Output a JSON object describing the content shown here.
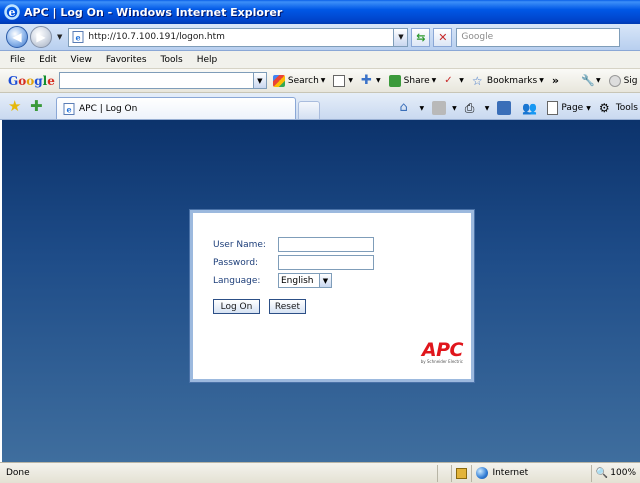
{
  "window": {
    "title": "APC | Log On - Windows Internet Explorer"
  },
  "address_bar": {
    "url": "http://10.7.100.191/logon.htm",
    "search_placeholder": "Google"
  },
  "menu": {
    "items": [
      "File",
      "Edit",
      "View",
      "Favorites",
      "Tools",
      "Help"
    ]
  },
  "google_toolbar": {
    "logo": {
      "G": "G",
      "o1": "o",
      "o2": "o",
      "g": "g",
      "l": "l",
      "e": "e"
    },
    "search_label": "Search",
    "share_label": "Share",
    "bookmarks_label": "Bookmarks",
    "more_label": "»",
    "sign_label": "Sig"
  },
  "tab": {
    "label": "APC | Log On"
  },
  "command_bar": {
    "page_label": "Page",
    "tools_label": "Tools"
  },
  "login": {
    "username_label": "User Name:",
    "username_value": "",
    "password_label": "Password:",
    "password_value": "",
    "language_label": "Language:",
    "language_value": "English",
    "logon_button": "Log On",
    "reset_button": "Reset",
    "brand": "APC",
    "brand_byline": "by Schneider Electric"
  },
  "status_bar": {
    "status": "Done",
    "zone": "Internet",
    "zoom": "100%"
  },
  "colors": {
    "brand_red": "#E0161C",
    "page_bg_top": "#0C336C",
    "titlebar_blue": "#0058E6"
  }
}
